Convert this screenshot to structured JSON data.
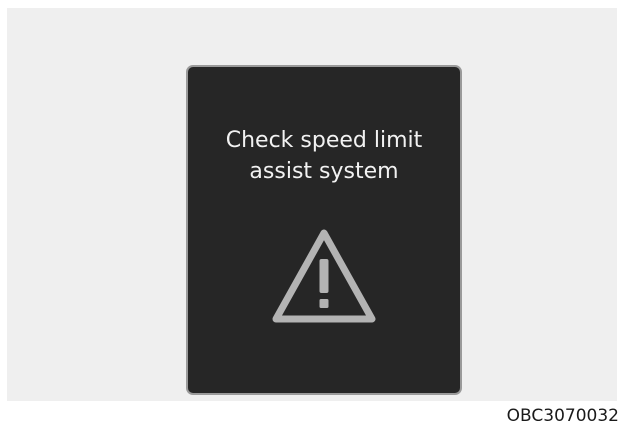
{
  "display": {
    "message_line1": "Check speed limit",
    "message_line2": "assist system",
    "icon": "warning-triangle-icon"
  },
  "figure_code": "OBC3070032",
  "colors": {
    "panel_background": "#262626",
    "panel_border": "#9a9a9a",
    "text": "#f2f2f2",
    "icon": "#b3b3b3",
    "page_background": "#efefef"
  }
}
